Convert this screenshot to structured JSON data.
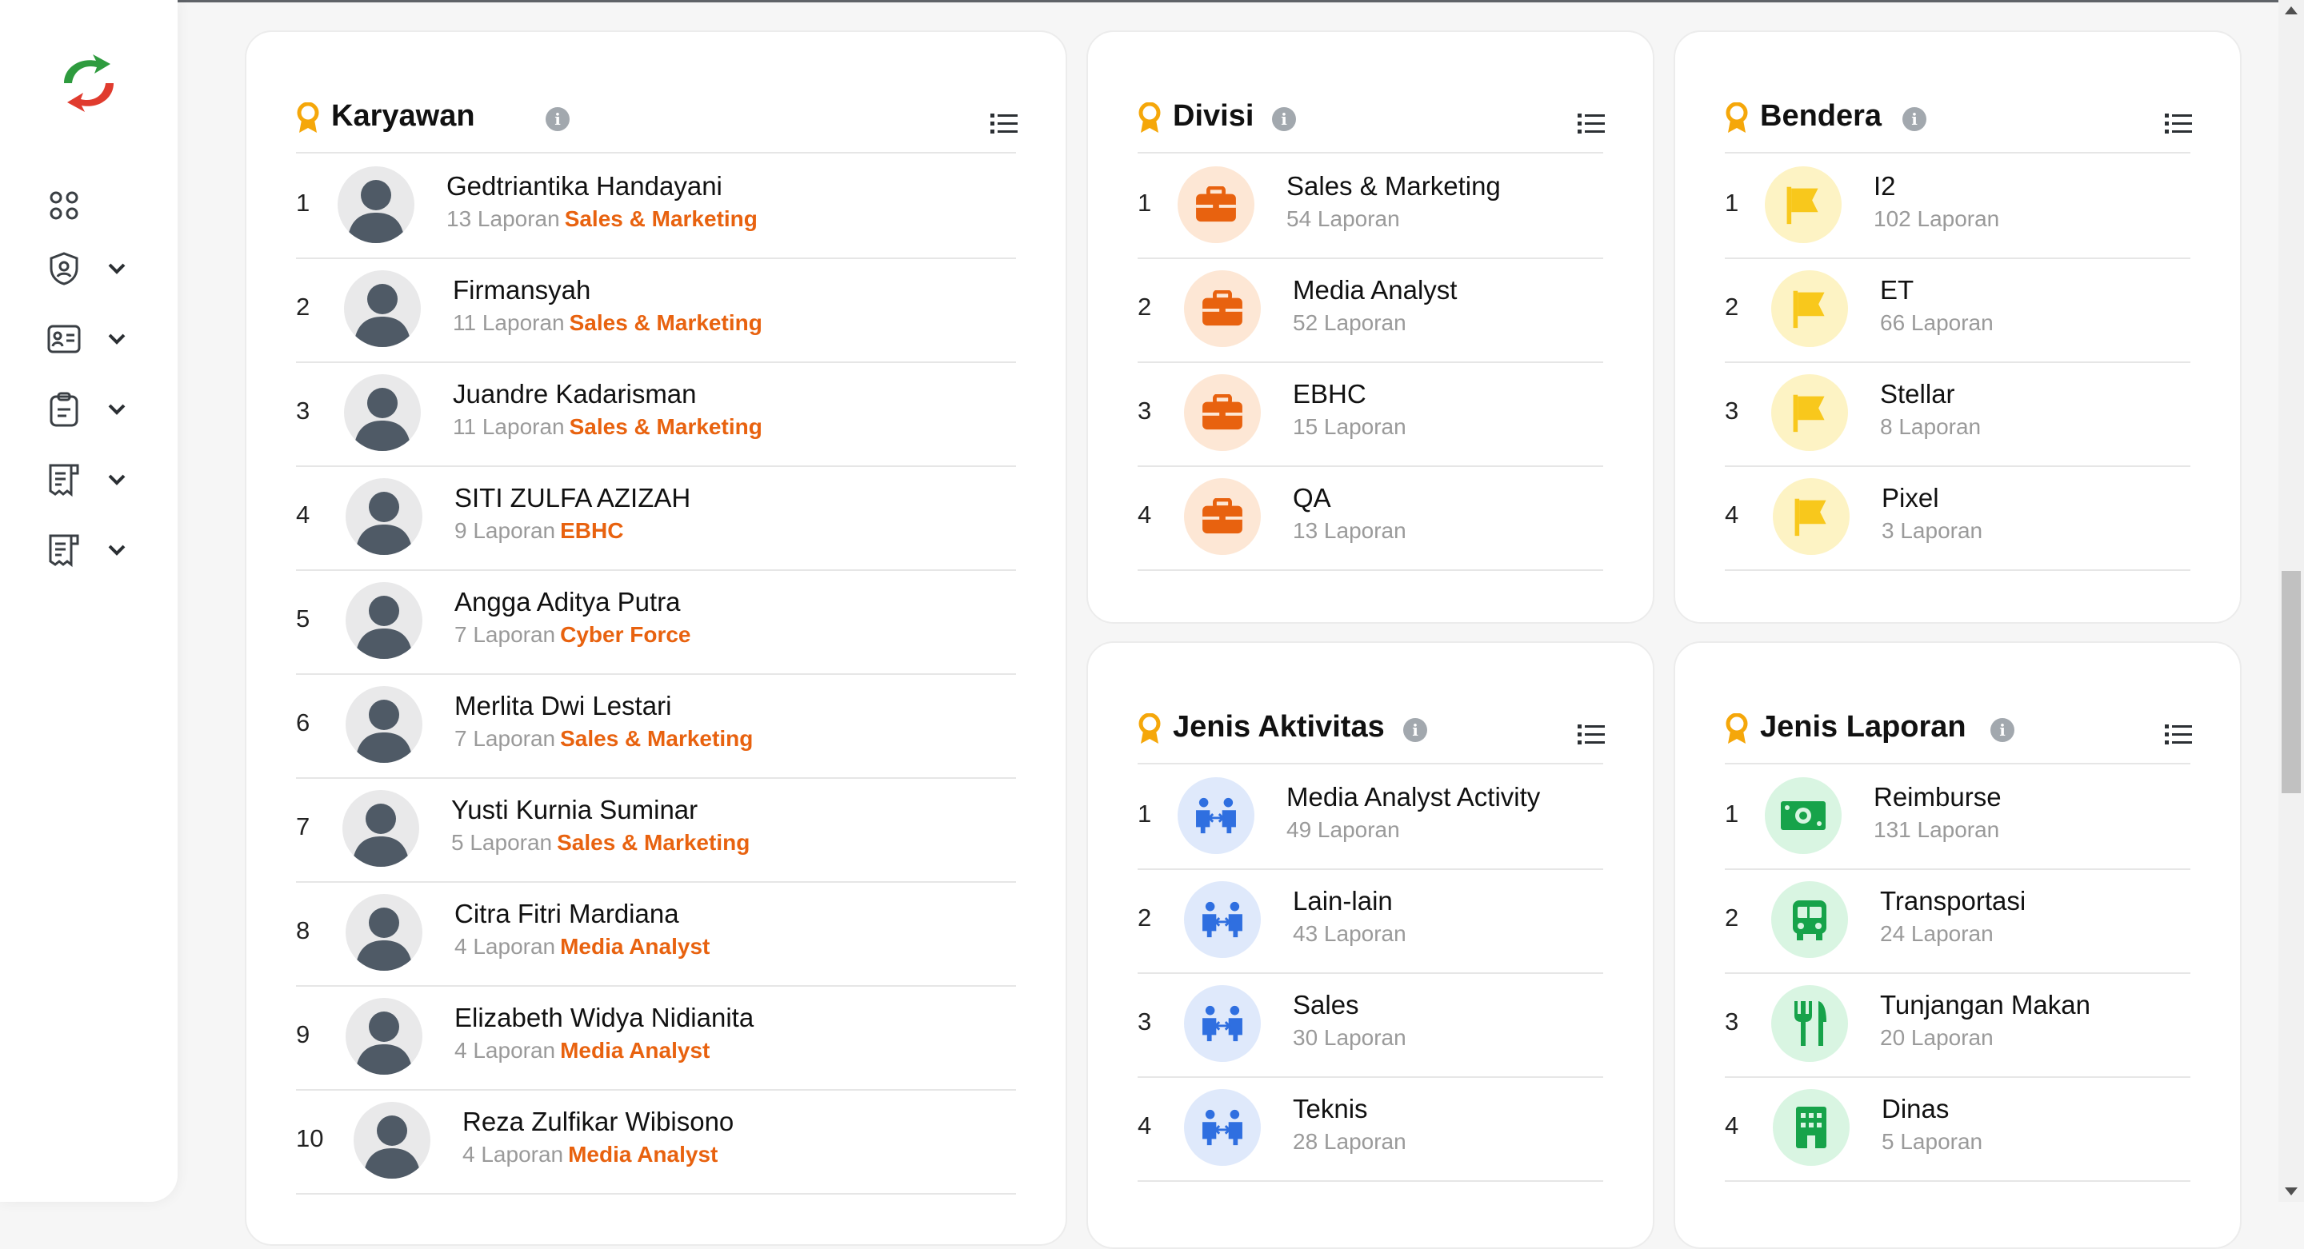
{
  "colors": {
    "accent_orange": "#e8620f",
    "yellow": "#f8c81c",
    "blue": "#2f6fe0",
    "green": "#17a34a"
  },
  "sidebar": {
    "logo": "refresh-logo-icon",
    "items": [
      {
        "icon": "apps-grid-icon"
      },
      {
        "icon": "shield-user-icon",
        "chevron": "chevron-down-icon"
      },
      {
        "icon": "id-card-icon",
        "chevron": "chevron-down-icon"
      },
      {
        "icon": "clipboard-icon",
        "chevron": "chevron-down-icon"
      },
      {
        "icon": "receipt-icon",
        "chevron": "chevron-down-icon"
      },
      {
        "icon": "receipt-icon",
        "chevron": "chevron-down-icon"
      }
    ]
  },
  "karyawan": {
    "title": "Karyawan",
    "info": "i",
    "rows": [
      {
        "rank": "1",
        "name": "Gedtriantika Handayani",
        "count": "13 Laporan",
        "dept": "Sales & Marketing"
      },
      {
        "rank": "2",
        "name": "Firmansyah",
        "count": "11 Laporan",
        "dept": "Sales & Marketing"
      },
      {
        "rank": "3",
        "name": "Juandre Kadarisman",
        "count": "11 Laporan",
        "dept": "Sales & Marketing"
      },
      {
        "rank": "4",
        "name": "SITI ZULFA AZIZAH",
        "count": "9 Laporan",
        "dept": "EBHC"
      },
      {
        "rank": "5",
        "name": "Angga Aditya Putra",
        "count": "7 Laporan",
        "dept": "Cyber Force"
      },
      {
        "rank": "6",
        "name": "Merlita Dwi Lestari",
        "count": "7 Laporan",
        "dept": "Sales & Marketing"
      },
      {
        "rank": "7",
        "name": "Yusti Kurnia Suminar",
        "count": "5 Laporan",
        "dept": "Sales & Marketing"
      },
      {
        "rank": "8",
        "name": "Citra Fitri Mardiana",
        "count": "4 Laporan",
        "dept": "Media Analyst"
      },
      {
        "rank": "9",
        "name": "Elizabeth Widya Nidianita",
        "count": "4 Laporan",
        "dept": "Media Analyst"
      },
      {
        "rank": "10",
        "name": "Reza Zulfikar Wibisono",
        "count": "4 Laporan",
        "dept": "Media Analyst"
      }
    ]
  },
  "divisi": {
    "title": "Divisi",
    "info": "i",
    "rows": [
      {
        "rank": "1",
        "name": "Sales & Marketing",
        "count": "54 Laporan"
      },
      {
        "rank": "2",
        "name": "Media Analyst",
        "count": "52 Laporan"
      },
      {
        "rank": "3",
        "name": "EBHC",
        "count": "15 Laporan"
      },
      {
        "rank": "4",
        "name": "QA",
        "count": "13 Laporan"
      }
    ]
  },
  "bendera": {
    "title": "Bendera",
    "info": "i",
    "rows": [
      {
        "rank": "1",
        "name": "I2",
        "count": "102 Laporan"
      },
      {
        "rank": "2",
        "name": "ET",
        "count": "66 Laporan"
      },
      {
        "rank": "3",
        "name": "Stellar",
        "count": "8 Laporan"
      },
      {
        "rank": "4",
        "name": "Pixel",
        "count": "3 Laporan"
      }
    ]
  },
  "jenis_aktivitas": {
    "title": "Jenis Aktivitas",
    "info": "i",
    "rows": [
      {
        "rank": "1",
        "name": "Media Analyst Activity",
        "count": "49 Laporan"
      },
      {
        "rank": "2",
        "name": "Lain-lain",
        "count": "43 Laporan"
      },
      {
        "rank": "3",
        "name": "Sales",
        "count": "30 Laporan"
      },
      {
        "rank": "4",
        "name": "Teknis",
        "count": "28 Laporan"
      }
    ]
  },
  "jenis_laporan": {
    "title": "Jenis Laporan",
    "info": "i",
    "rows": [
      {
        "rank": "1",
        "name": "Reimburse",
        "count": "131 Laporan",
        "icon": "money-icon"
      },
      {
        "rank": "2",
        "name": "Transportasi",
        "count": "24 Laporan",
        "icon": "bus-icon"
      },
      {
        "rank": "3",
        "name": "Tunjangan Makan",
        "count": "20 Laporan",
        "icon": "fork-knife-icon"
      },
      {
        "rank": "4",
        "name": "Dinas",
        "count": "5 Laporan",
        "icon": "building-icon"
      }
    ]
  }
}
